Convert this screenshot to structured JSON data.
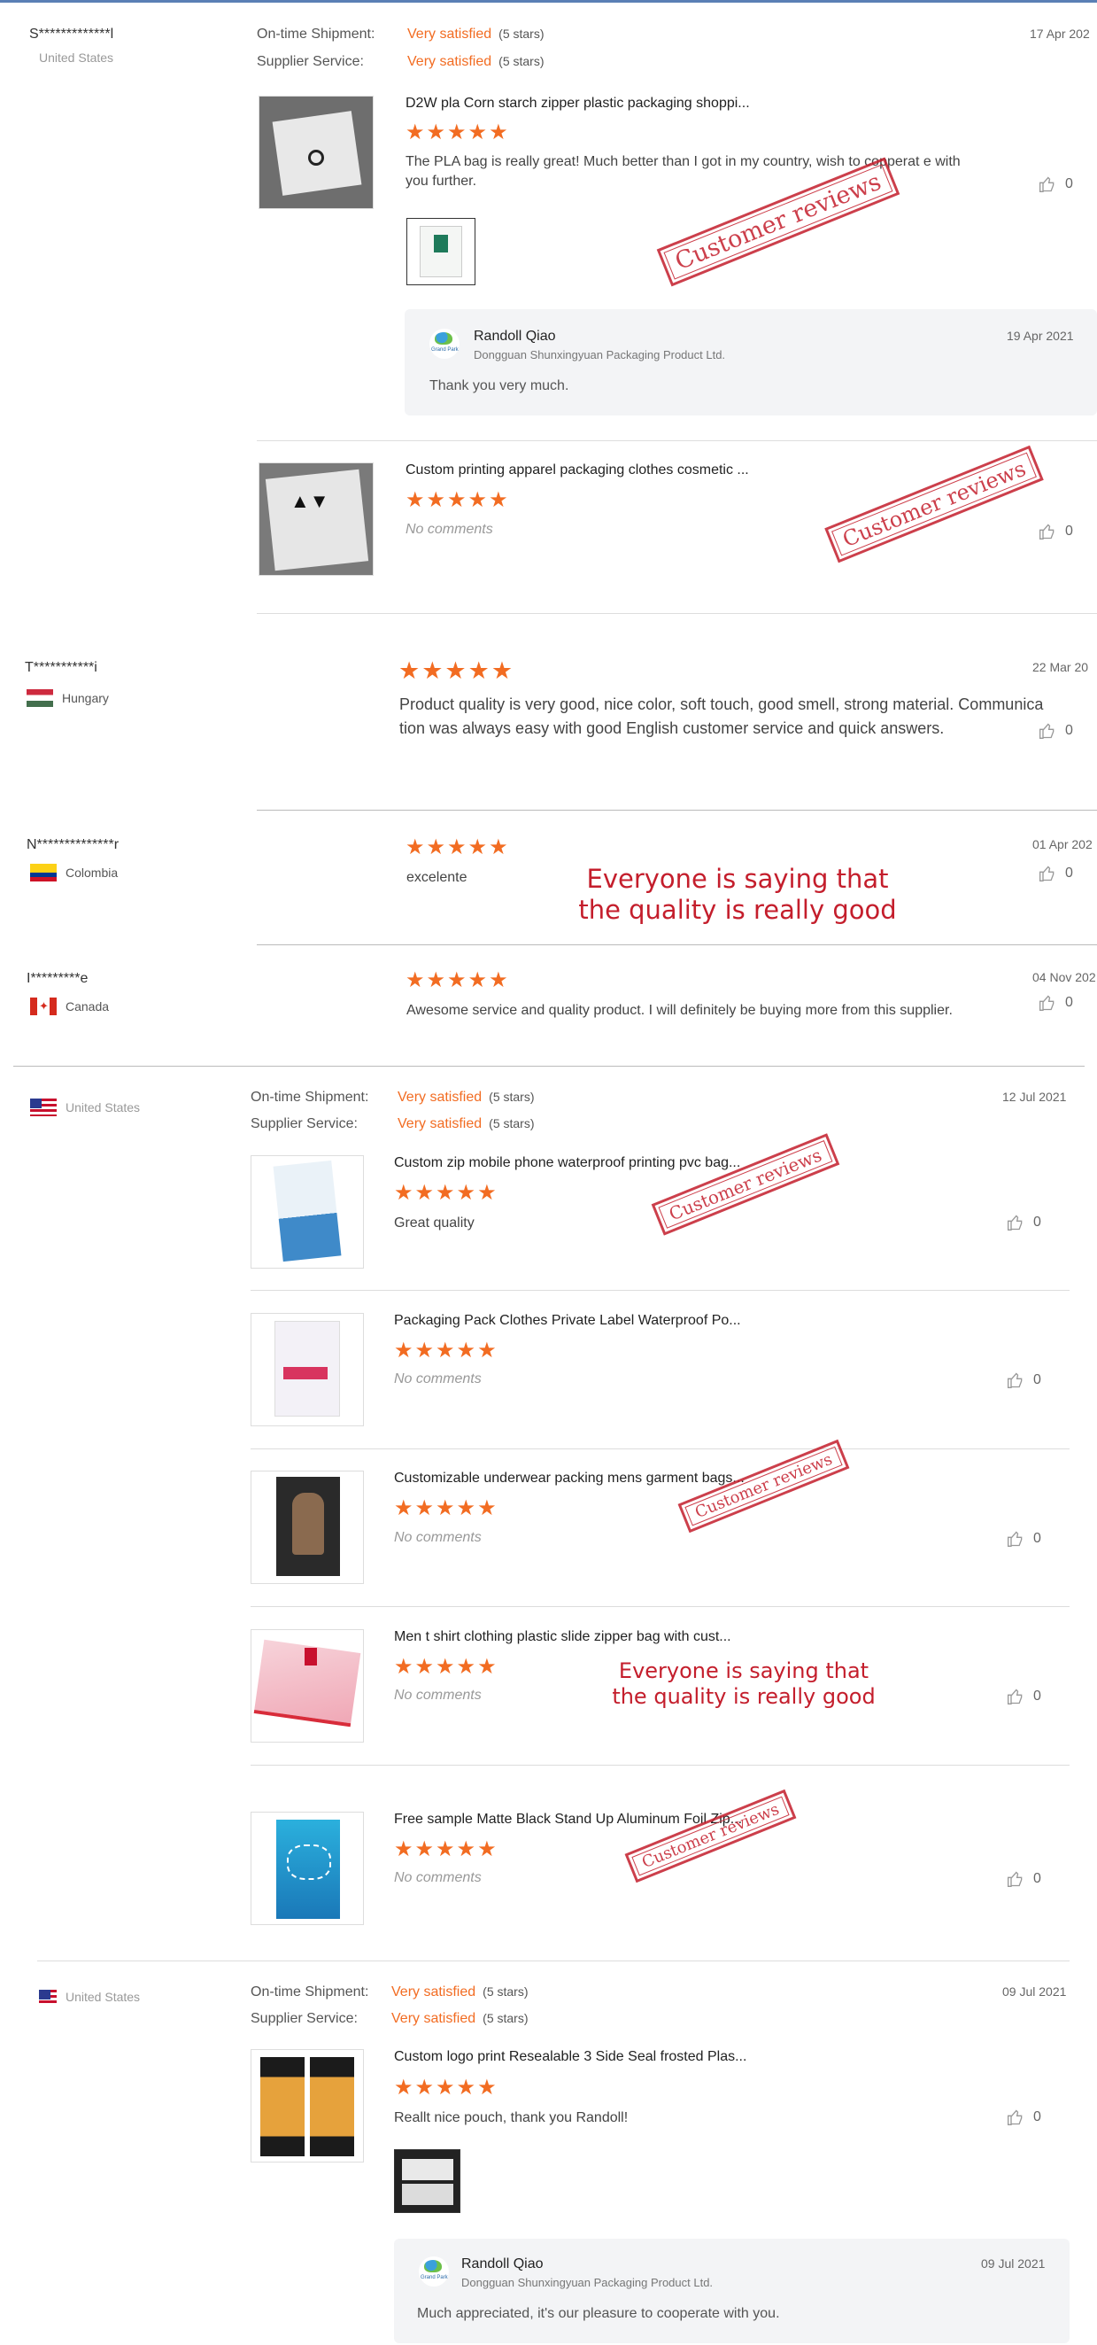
{
  "labels": {
    "on_time": "On-time Shipment:",
    "supplier_service": "Supplier Service:",
    "very_satisfied": "Very satisfied",
    "five_stars": "(5 stars)",
    "no_comments": "No comments",
    "stars": "★★★★★",
    "likes": "0"
  },
  "stamp_text": "Customer reviews",
  "overlay_text": {
    "line1": "Everyone is saying that",
    "line2": "the quality is really good"
  },
  "supplier_reply": {
    "name": "Randoll Qiao",
    "company": "Dongguan Shunxingyuan Packaging Product Ltd."
  },
  "reviews": [
    {
      "user": "S*************l",
      "country": "United States",
      "date": "17 Apr 202",
      "products": [
        {
          "title": "D2W pla Corn starch zipper plastic packaging shoppi...",
          "comment": "The PLA bag is really great! Much better than I got in my country, wish to copperat e with you further.",
          "reply": {
            "date": "19 Apr 2021",
            "text": "Thank you very much."
          }
        },
        {
          "title": "Custom printing apparel packaging clothes cosmetic ..."
        }
      ]
    },
    {
      "user": "T***********i",
      "country": "Hungary",
      "date": "22 Mar 20",
      "comment_line1": "Product quality is very good, nice color, soft touch, good smell, strong material. Communica",
      "comment_line2": "tion was always easy with good English customer service and quick answers."
    },
    {
      "user": "N**************r",
      "country": "Colombia",
      "date": "01 Apr 202",
      "comment": "excelente"
    },
    {
      "user": "I*********e",
      "country": "Canada",
      "date": "04 Nov 202",
      "comment": "Awesome service and quality product. I will definitely be buying more from this supplier."
    },
    {
      "country": "United States",
      "date": "12 Jul 2021",
      "products": [
        {
          "title": "Custom zip mobile phone waterproof printing pvc bag...",
          "comment": "Great quality"
        },
        {
          "title": "Packaging Pack Clothes Private Label Waterproof Po..."
        },
        {
          "title": "Customizable underwear packing mens garment bags..."
        },
        {
          "title": "Men t shirt clothing plastic slide zipper bag with cust..."
        },
        {
          "title": "Free sample Matte Black Stand Up Aluminum Foil Zip..."
        }
      ]
    },
    {
      "country": "United States",
      "date": "09 Jul 2021",
      "products": [
        {
          "title": "Custom logo print Resealable 3 Side Seal frosted Plas...",
          "comment": "Reallt nice pouch, thank you Randoll!",
          "reply": {
            "date": "09 Jul 2021",
            "text": "Much appreciated, it's our pleasure to cooperate with you."
          }
        }
      ]
    }
  ]
}
